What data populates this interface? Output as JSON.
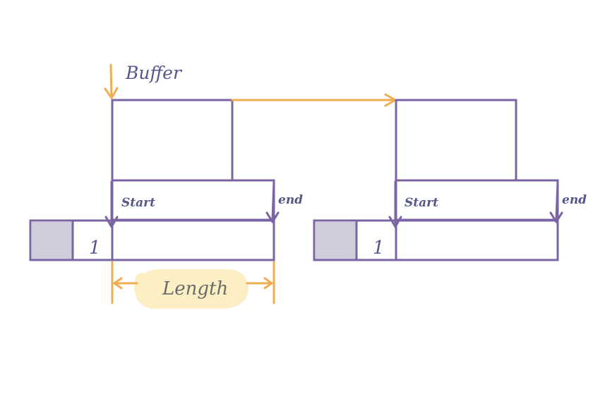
{
  "labels": {
    "buffer": "Buffer",
    "length": "Length"
  },
  "nodes": [
    {
      "start_label": "Start",
      "end_label": "end",
      "count": "1"
    },
    {
      "start_label": "Start",
      "end_label": "end",
      "count": "1"
    }
  ],
  "colors": {
    "outline": "#7a64a3",
    "pointer": "#f0ad52",
    "refcount_fill": "#cdcddc",
    "label_text": "#55568a",
    "length_text": "#6b6b6b",
    "length_highlight": "#fcefc4"
  }
}
